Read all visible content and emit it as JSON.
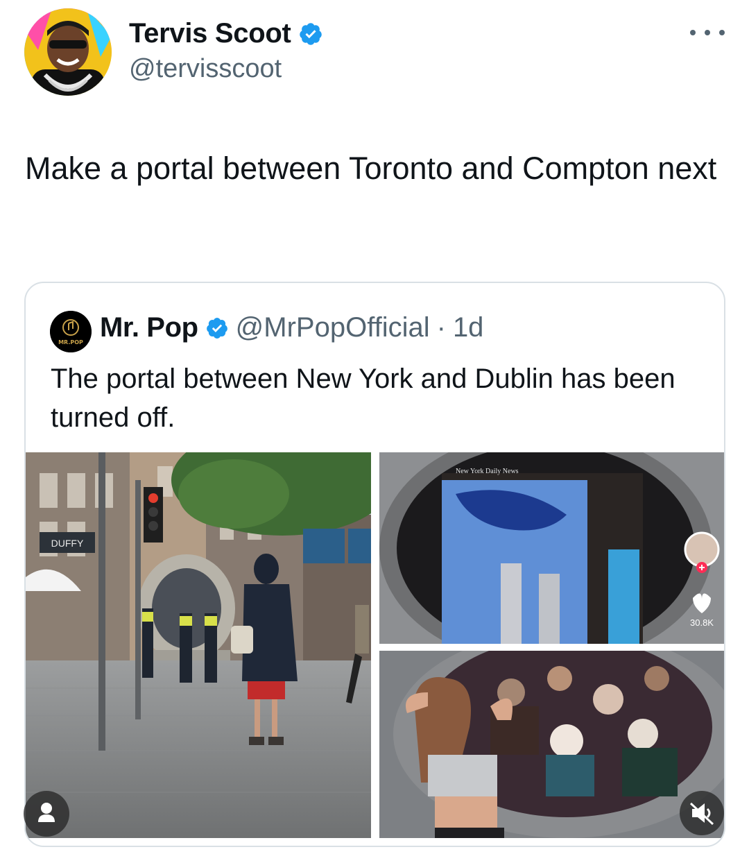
{
  "post": {
    "author": {
      "display_name": "Tervis Scoot",
      "handle": "@tervisscoot",
      "verified": true,
      "avatar_icon": "rapper-avatar"
    },
    "text": "Make a portal between Toronto and Compton next",
    "more_icon": "more-horizontal-icon"
  },
  "quote": {
    "author": {
      "display_name": "Mr. Pop",
      "handle": "@MrPopOfficial",
      "separator": "·",
      "time": "1d",
      "verified": true,
      "avatar_text": "MR.POP"
    },
    "text": "The portal between New York and Dublin has been turned off.",
    "media": [
      {
        "kind": "photo",
        "subject": "dublin-street-portal",
        "sign_text": "DUFFY"
      },
      {
        "kind": "video-still",
        "subject": "portal-screen-twin-towers",
        "overlay_label": "New York Daily News",
        "like_count": "30.8K"
      },
      {
        "kind": "video-still",
        "subject": "portal-crowd-selfie"
      }
    ]
  },
  "colors": {
    "text_primary": "#0f1419",
    "text_secondary": "#536471",
    "verified_blue": "#1d9bf0",
    "card_border": "#d9e0e5"
  }
}
